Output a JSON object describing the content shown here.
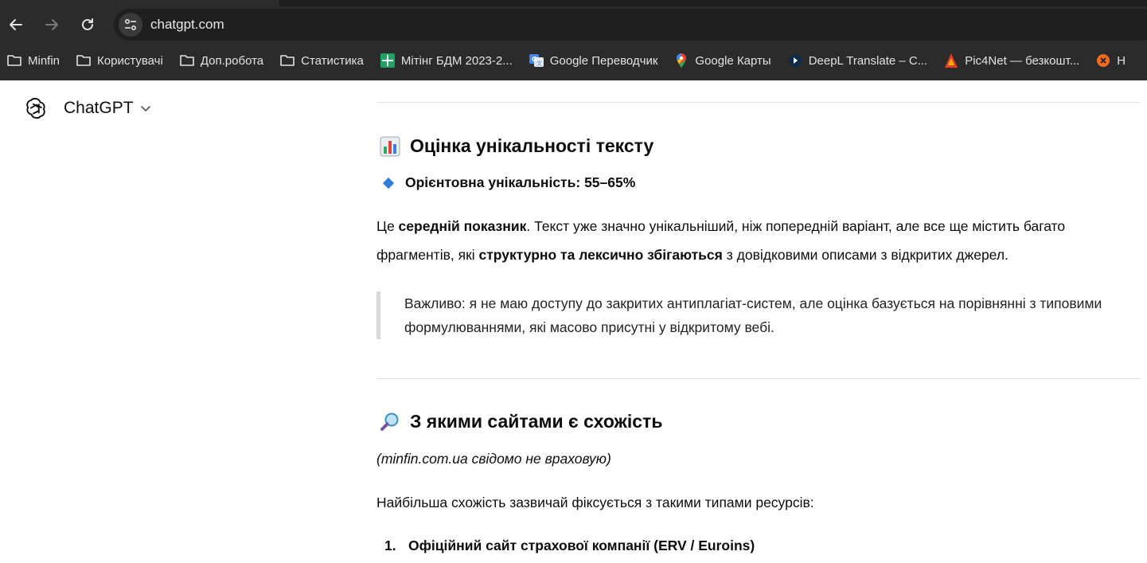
{
  "browser": {
    "url": "chatgpt.com",
    "bookmarks": [
      {
        "label": "Minfin",
        "icon": "folder-icon"
      },
      {
        "label": "Користувачі",
        "icon": "folder-icon"
      },
      {
        "label": "Доп.робота",
        "icon": "folder-icon"
      },
      {
        "label": "Статистика",
        "icon": "folder-icon"
      },
      {
        "label": "Мітінг БДМ 2023-2...",
        "icon": "sheets-icon"
      },
      {
        "label": "Google Переводчик",
        "icon": "translate-icon"
      },
      {
        "label": "Google Карты",
        "icon": "maps-pin-icon"
      },
      {
        "label": "DeepL Translate – C...",
        "icon": "deepl-icon"
      },
      {
        "label": "Pic4Net — безкошт...",
        "icon": "pic4net-icon"
      },
      {
        "label": "Н",
        "icon": "close-circle-icon"
      }
    ]
  },
  "app": {
    "name": "ChatGPT"
  },
  "message": {
    "section1": {
      "heading": "Оцінка унікальності тексту",
      "bullet_label": "Орієнтовна унікальність: 55–65%",
      "para_parts": [
        "Це ",
        "середній показник",
        ". Текст уже значно унікальніший, ніж попередній варіант, але все ще містить багато фрагментів, які ",
        "структурно та лексично збігаються",
        " з довідковими описами з відкритих джерел."
      ],
      "quote": "Важливо: я не маю доступу до закритих антиплагіат-систем, але оцінка базується на порівнянні з типовими формулюваннями, які масово присутні у відкритому вебі."
    },
    "section2": {
      "heading": "З якими сайтами є схожість",
      "note": "(minfin.com.ua свідомо не враховую)",
      "intro": "Найбільша схожість зазвичай фіксується з такими типами ресурсів:",
      "items": [
        {
          "num": "1.",
          "text": "Офіційний сайт страхової компанії (ERV / Euroins)"
        }
      ]
    }
  }
}
